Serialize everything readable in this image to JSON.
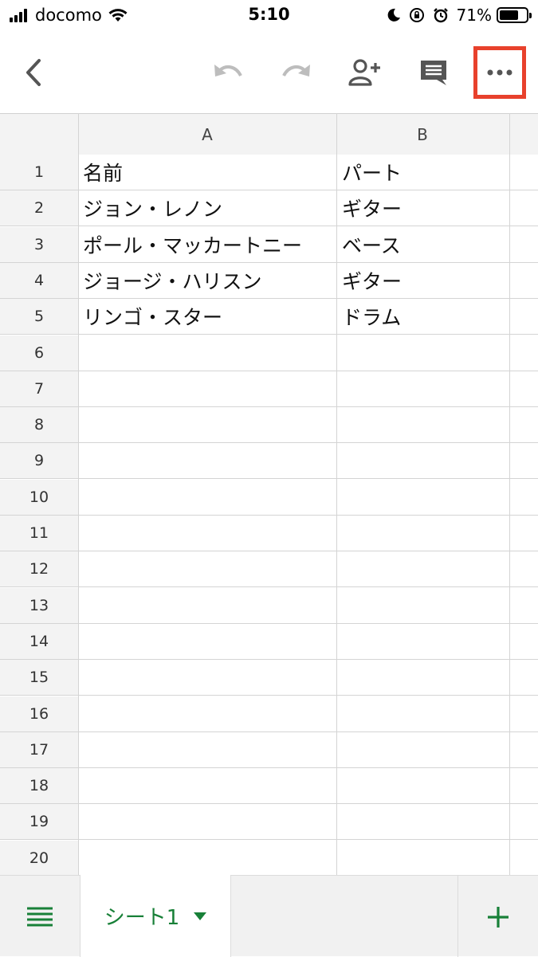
{
  "status_bar": {
    "carrier": "docomo",
    "time": "5:10",
    "battery_percent": "71%",
    "battery_level": 0.71
  },
  "toolbar": {
    "icons": [
      "back-icon",
      "undo-icon",
      "redo-icon",
      "add-person-icon",
      "comment-icon",
      "more-icon"
    ],
    "highlight_color": "#e8412c"
  },
  "grid": {
    "columns": [
      "A",
      "B"
    ],
    "rows": [
      {
        "num": "1",
        "a": "名前",
        "b": "パート"
      },
      {
        "num": "2",
        "a": "ジョン・レノン",
        "b": "ギター"
      },
      {
        "num": "3",
        "a": "ポール・マッカートニー",
        "b": "ベース"
      },
      {
        "num": "4",
        "a": "ジョージ・ハリスン",
        "b": "ギター"
      },
      {
        "num": "5",
        "a": "リンゴ・スター",
        "b": "ドラム"
      },
      {
        "num": "6",
        "a": "",
        "b": ""
      },
      {
        "num": "7",
        "a": "",
        "b": ""
      },
      {
        "num": "8",
        "a": "",
        "b": ""
      },
      {
        "num": "9",
        "a": "",
        "b": ""
      },
      {
        "num": "10",
        "a": "",
        "b": ""
      },
      {
        "num": "11",
        "a": "",
        "b": ""
      },
      {
        "num": "12",
        "a": "",
        "b": ""
      },
      {
        "num": "13",
        "a": "",
        "b": ""
      },
      {
        "num": "14",
        "a": "",
        "b": ""
      },
      {
        "num": "15",
        "a": "",
        "b": ""
      },
      {
        "num": "16",
        "a": "",
        "b": ""
      },
      {
        "num": "17",
        "a": "",
        "b": ""
      },
      {
        "num": "18",
        "a": "",
        "b": ""
      },
      {
        "num": "19",
        "a": "",
        "b": ""
      },
      {
        "num": "20",
        "a": "",
        "b": ""
      }
    ]
  },
  "bottom_bar": {
    "sheet_tab_label": "シート1",
    "accent_color": "#188038"
  }
}
